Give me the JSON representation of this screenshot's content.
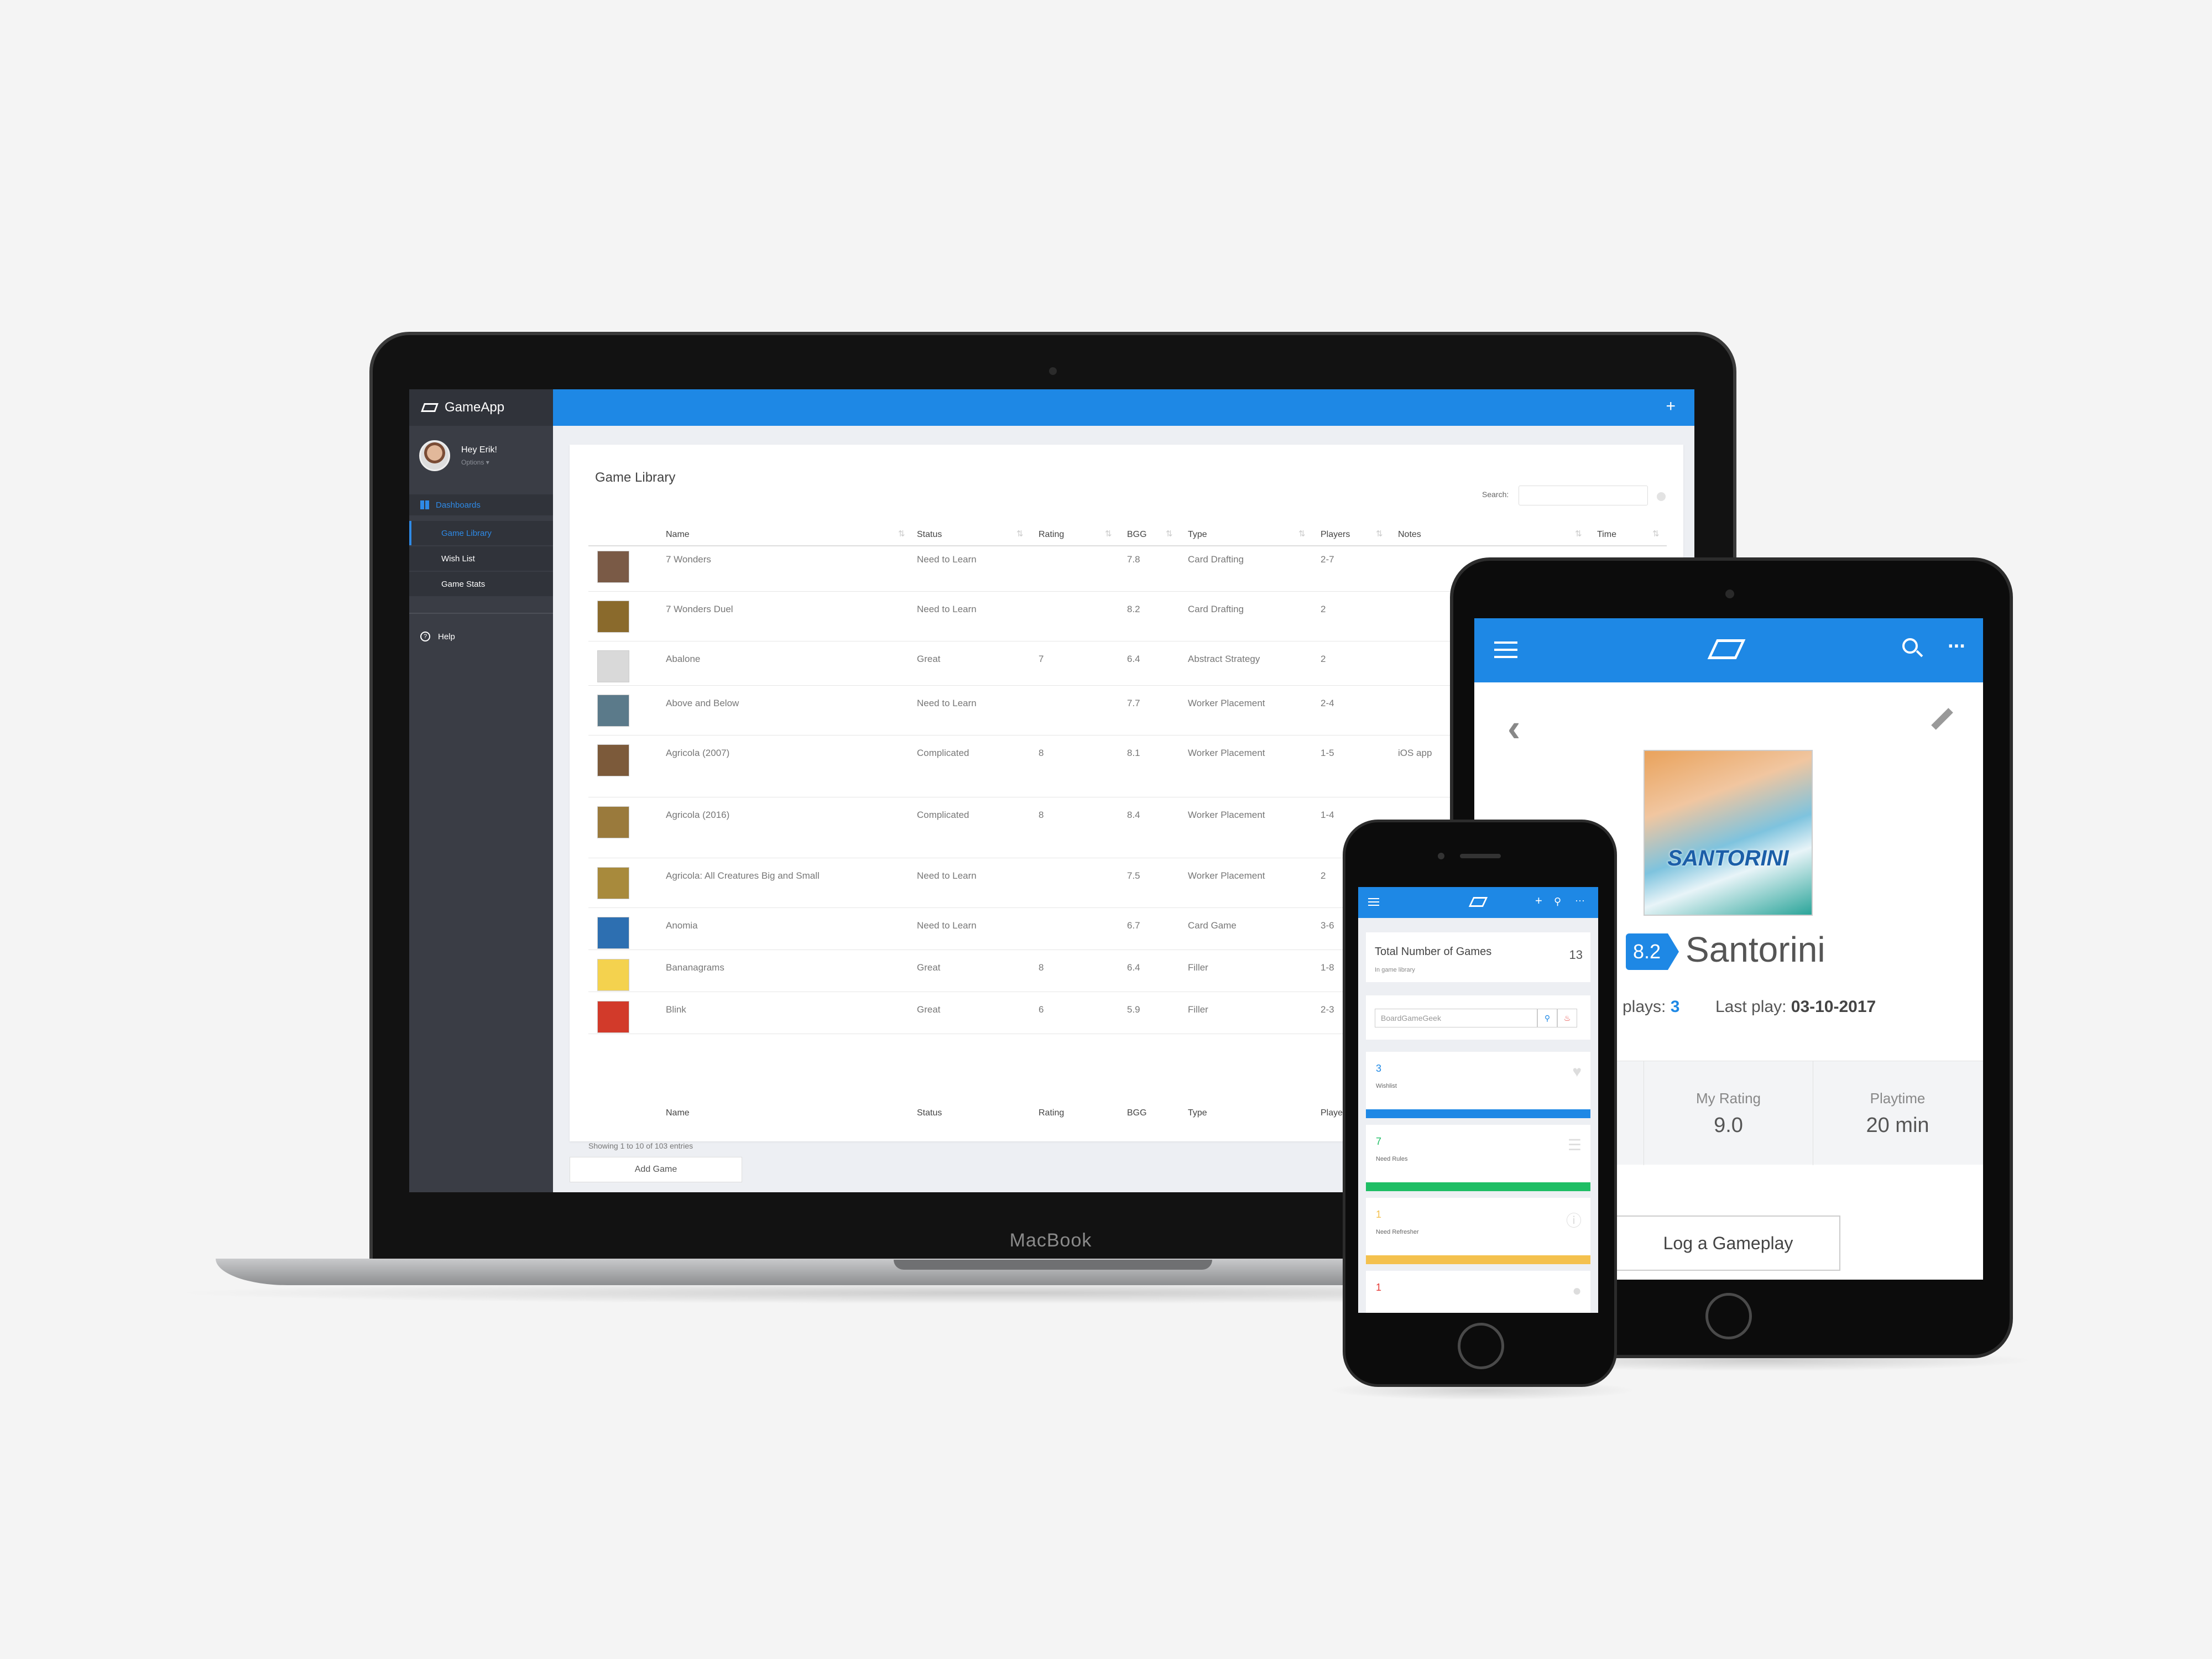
{
  "laptop": {
    "device_label": "MacBook",
    "brand": "GameApp",
    "user": {
      "greeting": "Hey Erik!",
      "options": "Options ▾"
    },
    "sidebar": {
      "section": "Dashboards",
      "items": [
        {
          "label": "Game Library"
        },
        {
          "label": "Wish List"
        },
        {
          "label": "Game Stats"
        }
      ],
      "help": "Help"
    },
    "topbar": {
      "add_label": "+"
    },
    "library": {
      "title": "Game Library",
      "search_label": "Search:",
      "columns": [
        "Name",
        "Status",
        "Rating",
        "BGG",
        "Type",
        "Players",
        "Notes",
        "Time"
      ],
      "rows": [
        {
          "name": "7 Wonders",
          "status": "Need to Learn",
          "rating": "",
          "bgg": "7.8",
          "type": "Card Drafting",
          "players": "2-7",
          "notes": "",
          "time": ""
        },
        {
          "name": "7 Wonders Duel",
          "status": "Need to Learn",
          "rating": "",
          "bgg": "8.2",
          "type": "Card Drafting",
          "players": "2",
          "notes": "",
          "time": ""
        },
        {
          "name": "Abalone",
          "status": "Great",
          "rating": "7",
          "bgg": "6.4",
          "type": "Abstract Strategy",
          "players": "2",
          "notes": "",
          "time": ""
        },
        {
          "name": "Above and Below",
          "status": "Need to Learn",
          "rating": "",
          "bgg": "7.7",
          "type": "Worker Placement",
          "players": "2-4",
          "notes": "",
          "time": ""
        },
        {
          "name": "Agricola (2007)",
          "status": "Complicated",
          "rating": "8",
          "bgg": "8.1",
          "type": "Worker Placement",
          "players": "1-5",
          "notes": "iOS app",
          "time": ""
        },
        {
          "name": "Agricola (2016)",
          "status": "Complicated",
          "rating": "8",
          "bgg": "8.4",
          "type": "Worker Placement",
          "players": "1-4",
          "notes": "",
          "time": ""
        },
        {
          "name": "Agricola: All Creatures Big and Small",
          "status": "Need to Learn",
          "rating": "",
          "bgg": "7.5",
          "type": "Worker Placement",
          "players": "2",
          "notes": "",
          "time": ""
        },
        {
          "name": "Anomia",
          "status": "Need to Learn",
          "rating": "",
          "bgg": "6.7",
          "type": "Card Game",
          "players": "3-6",
          "notes": "",
          "time": ""
        },
        {
          "name": "Bananagrams",
          "status": "Great",
          "rating": "8",
          "bgg": "6.4",
          "type": "Filler",
          "players": "1-8",
          "notes": "",
          "time": ""
        },
        {
          "name": "Blink",
          "status": "Great",
          "rating": "6",
          "bgg": "5.9",
          "type": "Filler",
          "players": "2-3",
          "notes": "",
          "time": ""
        }
      ],
      "footer_columns": [
        "Name",
        "Status",
        "Rating",
        "BGG",
        "Type",
        "Players"
      ],
      "showing": "Showing 1 to 10 of 103 entries",
      "add_button": "Add Game"
    }
  },
  "tablet": {
    "cover_title": "SANTORINI",
    "score": "8.2",
    "game_name": "Santorini",
    "plays_label": "plays:",
    "plays_value": "3",
    "last_play_label": "Last play:",
    "last_play_value": "03-10-2017",
    "stats": [
      {
        "label": "",
        "value": ""
      },
      {
        "label": "My Rating",
        "value": "9.0"
      },
      {
        "label": "Playtime",
        "value": "20 min"
      }
    ],
    "log_button": "Log a Gameplay"
  },
  "phone": {
    "icons": {
      "add": "+",
      "search": "⚲",
      "more": "···"
    },
    "total": {
      "title": "Total Number of Games",
      "subtitle": "In game library",
      "value": "13"
    },
    "bgg_search": {
      "placeholder": "BoardGameGeek"
    },
    "stats": [
      {
        "value": "3",
        "label": "Wishlist",
        "color": "#1e88e5",
        "icon": "heart-icon"
      },
      {
        "value": "7",
        "label": "Need Rules",
        "color": "#1fbe65",
        "icon": "list-icon"
      },
      {
        "value": "1",
        "label": "Need Refresher",
        "color": "#f4c14e",
        "icon": "info-icon"
      },
      {
        "value": "1",
        "label": "",
        "color": "#e53935",
        "icon": "circle-icon"
      }
    ]
  }
}
